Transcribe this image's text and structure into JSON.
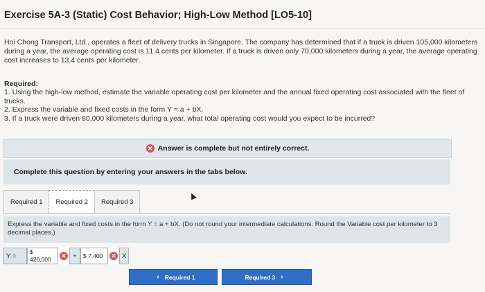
{
  "title": "Exercise 5A-3 (Static) Cost Behavior; High-Low Method [LO5-10]",
  "paragraph": "Hoi Chong Transport, Ltd., operates a fleet of delivery trucks in Singapore. The company has determined that if a truck is driven 105,000 kilometers during a year, the average operating cost is 11.4 cents per kilometer. If a truck is driven only 70,000 kilometers during a year, the average operating cost increases to 13.4 cents per kilometer.",
  "required_heading": "Required:",
  "required_items": [
    "1. Using the high-low method, estimate the variable operating cost per kilometer and the annual fixed operating cost associated with the fleet of trucks.",
    "2. Express the variable and fixed costs in the form Y = a + bX.",
    "3. If a truck were driven 80,000 kilometers during a year, what total operating cost would you expect to be incurred?"
  ],
  "banner_text": "Answer is complete but not entirely correct.",
  "complete_text": "Complete this question by entering your answers in the tabs below.",
  "tabs": [
    "Required 1",
    "Required 2",
    "Required 3"
  ],
  "active_tab": "Required 2",
  "instruction": "Express the variable and fixed costs in the form Y = a + bX. (Do not round your intermediate calculations. Round the Variable cost per kilometer to 3 decimal places.)",
  "equation": {
    "y_label": "Y =",
    "a_dollar": "$",
    "a_value": "420,000",
    "plus": "+",
    "b_value": "$ 7.400",
    "x_label": "X"
  },
  "nav": {
    "prev_label": "Required 1",
    "next_label": "Required 3"
  },
  "colors": {
    "accent": "#2f6ec6",
    "incorrect": "#d9534f",
    "panel": "#dde5e8"
  }
}
